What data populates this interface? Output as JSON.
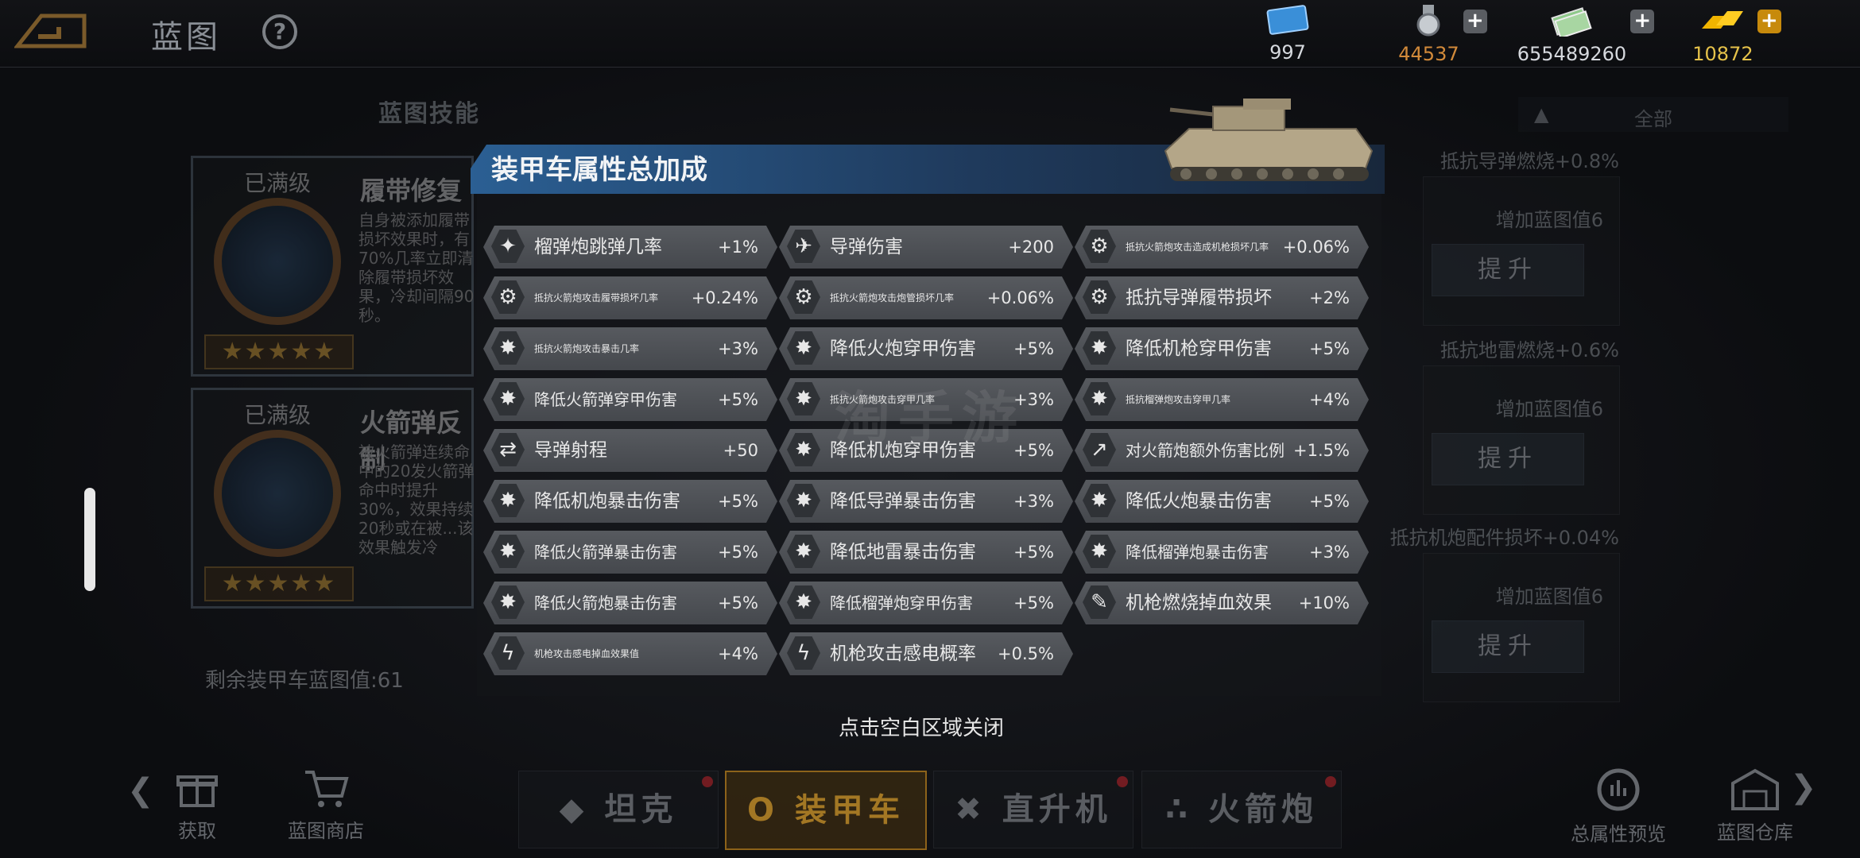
{
  "header": {
    "title": "蓝图"
  },
  "resources": [
    {
      "icon": "blueprint-ticket-icon",
      "value": "997",
      "color": "#d6d9de"
    },
    {
      "icon": "medal-icon",
      "value": "44537",
      "color": "#d28a3a"
    },
    {
      "icon": "cash-icon",
      "value": "655489260",
      "color": "#d6d9de"
    },
    {
      "icon": "gold-bar-icon",
      "value": "10872",
      "color": "#e6c24a"
    }
  ],
  "skills": {
    "section_title": "蓝图技能",
    "cards": [
      {
        "level": "已满级",
        "name": "履带修复",
        "desc": "自身被添加履带损坏效果时，有70%几率立即清除履带损坏效果，冷却间隔90秒。",
        "stars": "★★★★★"
      },
      {
        "level": "已满级",
        "name": "火箭弹反制",
        "desc": "被火箭弹连续命中的20发火箭弹命中时提升30%，效果持续20秒或在被...该效果触发冷",
        "stars": "★★★★★"
      }
    ],
    "remaining": "剩余装甲车蓝图值:61"
  },
  "right_panel": {
    "filter": "全部",
    "items": [
      {
        "head": "抵抗导弹燃烧+0.8%",
        "sub": "增加蓝图值6",
        "button": "提升"
      },
      {
        "head": "抵抗地雷燃烧+0.6%",
        "sub": "增加蓝图值6",
        "button": "提升"
      },
      {
        "head": "抵抗机炮配件损坏+0.04%",
        "sub": "增加蓝图值6",
        "button": "提升"
      }
    ]
  },
  "modal": {
    "title": "装甲车属性总加成",
    "close_hint": "点击空白区域关闭",
    "rows": [
      {
        "col": 0,
        "row": 0,
        "icon": "✦",
        "label": "榴弹炮跳弹几率",
        "value": "+1%",
        "size": "big"
      },
      {
        "col": 1,
        "row": 0,
        "icon": "✈",
        "label": "导弹伤害",
        "value": "+200",
        "size": "big"
      },
      {
        "col": 2,
        "row": 0,
        "icon": "⚙",
        "label": "抵抗火箭炮攻击造成机枪损坏几率",
        "value": "+0.06%",
        "size": "small"
      },
      {
        "col": 0,
        "row": 1,
        "icon": "⚙",
        "label": "抵抗火箭炮攻击履带损坏几率",
        "value": "+0.24%",
        "size": "small"
      },
      {
        "col": 1,
        "row": 1,
        "icon": "⚙",
        "label": "抵抗火箭炮攻击炮管损坏几率",
        "value": "+0.06%",
        "size": "small"
      },
      {
        "col": 2,
        "row": 1,
        "icon": "⚙",
        "label": "抵抗导弹履带损坏",
        "value": "+2%",
        "size": "big"
      },
      {
        "col": 0,
        "row": 2,
        "icon": "✸",
        "label": "抵抗火箭炮攻击暴击几率",
        "value": "+3%",
        "size": "small"
      },
      {
        "col": 1,
        "row": 2,
        "icon": "✸",
        "label": "降低火炮穿甲伤害",
        "value": "+5%",
        "size": "big"
      },
      {
        "col": 2,
        "row": 2,
        "icon": "✸",
        "label": "降低机枪穿甲伤害",
        "value": "+5%",
        "size": "big"
      },
      {
        "col": 0,
        "row": 3,
        "icon": "✸",
        "label": "降低火箭弹穿甲伤害",
        "value": "+5%",
        "size": "mid"
      },
      {
        "col": 1,
        "row": 3,
        "icon": "✸",
        "label": "抵抗火箭炮攻击穿甲几率",
        "value": "+3%",
        "size": "small"
      },
      {
        "col": 2,
        "row": 3,
        "icon": "✸",
        "label": "抵抗榴弹炮攻击穿甲几率",
        "value": "+4%",
        "size": "small"
      },
      {
        "col": 0,
        "row": 4,
        "icon": "⇄",
        "label": "导弹射程",
        "value": "+50",
        "size": "big"
      },
      {
        "col": 1,
        "row": 4,
        "icon": "✸",
        "label": "降低机炮穿甲伤害",
        "value": "+5%",
        "size": "big"
      },
      {
        "col": 2,
        "row": 4,
        "icon": "↗",
        "label": "对火箭炮额外伤害比例",
        "value": "+1.5%",
        "size": "mid"
      },
      {
        "col": 0,
        "row": 5,
        "icon": "✸",
        "label": "降低机炮暴击伤害",
        "value": "+5%",
        "size": "big"
      },
      {
        "col": 1,
        "row": 5,
        "icon": "✸",
        "label": "降低导弹暴击伤害",
        "value": "+3%",
        "size": "big"
      },
      {
        "col": 2,
        "row": 5,
        "icon": "✸",
        "label": "降低火炮暴击伤害",
        "value": "+5%",
        "size": "big"
      },
      {
        "col": 0,
        "row": 6,
        "icon": "✸",
        "label": "降低火箭弹暴击伤害",
        "value": "+5%",
        "size": "mid"
      },
      {
        "col": 1,
        "row": 6,
        "icon": "✸",
        "label": "降低地雷暴击伤害",
        "value": "+5%",
        "size": "big"
      },
      {
        "col": 2,
        "row": 6,
        "icon": "✸",
        "label": "降低榴弹炮暴击伤害",
        "value": "+3%",
        "size": "mid"
      },
      {
        "col": 0,
        "row": 7,
        "icon": "✸",
        "label": "降低火箭炮暴击伤害",
        "value": "+5%",
        "size": "mid"
      },
      {
        "col": 1,
        "row": 7,
        "icon": "✸",
        "label": "降低榴弹炮穿甲伤害",
        "value": "+5%",
        "size": "mid"
      },
      {
        "col": 2,
        "row": 7,
        "icon": "✎",
        "label": "机枪燃烧掉血效果",
        "value": "+10%",
        "size": "big"
      },
      {
        "col": 0,
        "row": 8,
        "icon": "ϟ",
        "label": "机枪攻击感电掉血效果值",
        "value": "+4%",
        "size": "small"
      },
      {
        "col": 1,
        "row": 8,
        "icon": "ϟ",
        "label": "机枪攻击感电概率",
        "value": "+0.5%",
        "size": "big"
      }
    ]
  },
  "bottom_nav": {
    "left_arrow": "❮",
    "right_arrow": "❯",
    "acquire": "获取",
    "shop": "蓝图商店",
    "tabs": [
      {
        "label": "坦克",
        "icon": "◆",
        "active": false
      },
      {
        "label": "装甲车",
        "icon": "O",
        "active": true
      },
      {
        "label": "直升机",
        "icon": "✖",
        "active": false
      },
      {
        "label": "火箭炮",
        "icon": "∴",
        "active": false
      }
    ],
    "preview": "总属性预览",
    "storage": "蓝图仓库"
  }
}
